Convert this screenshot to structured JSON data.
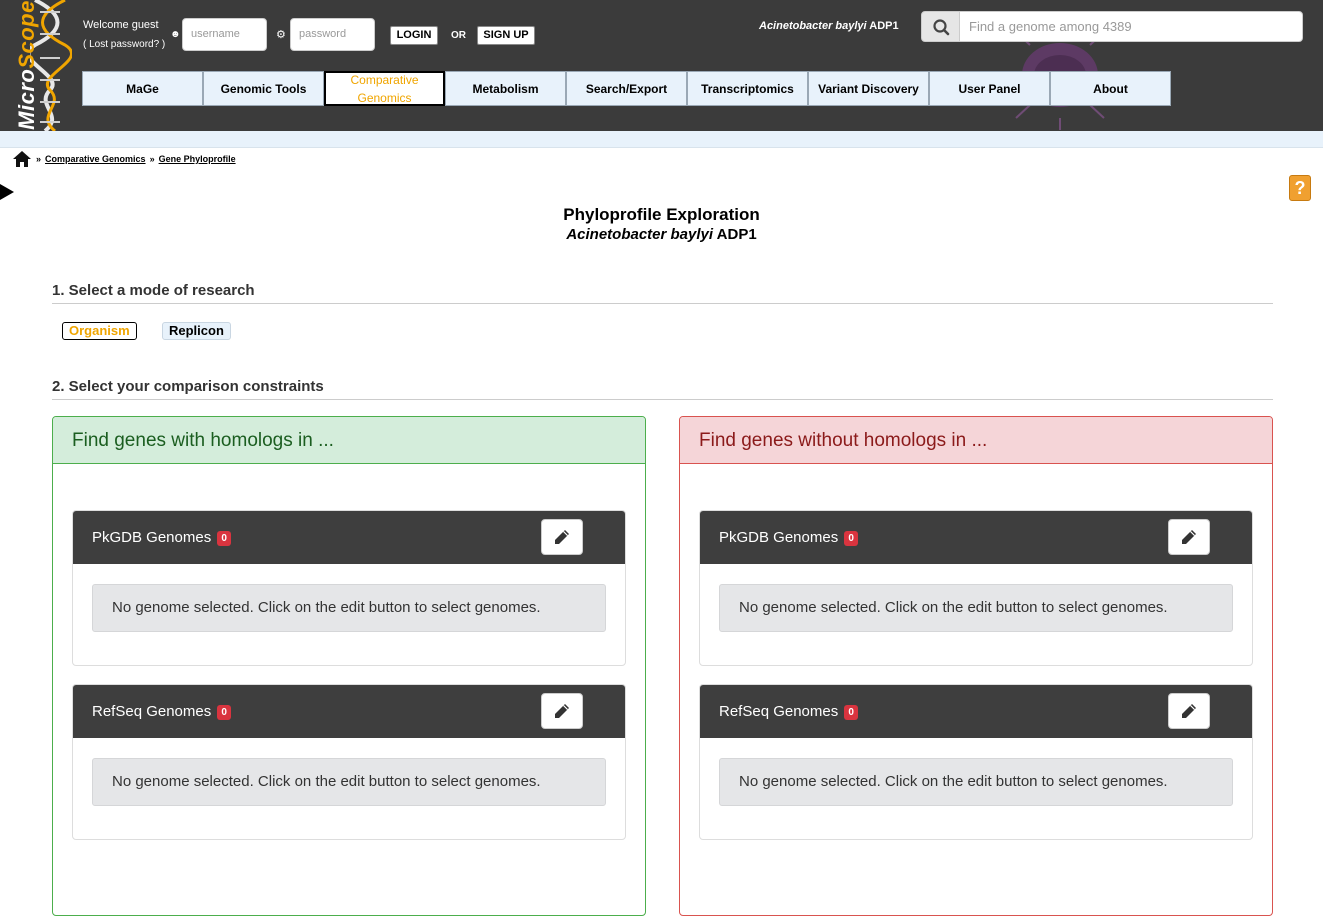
{
  "header": {
    "logo_micro": "Micro",
    "logo_scope": "Scope",
    "welcome": "Welcome guest",
    "lost_password": "( Lost password? )",
    "username_placeholder": "username",
    "password_placeholder": "password",
    "login_label": "LOGIN",
    "or_label": "OR",
    "signup_label": "SIGN UP",
    "organism_italic": "Acinetobacter baylyi",
    "organism_strain": "ADP1",
    "search_placeholder": "Find a genome among 4389"
  },
  "nav": {
    "items": [
      {
        "label": "MaGe"
      },
      {
        "label": "Genomic Tools"
      },
      {
        "label": "Comparative Genomics"
      },
      {
        "label": "Metabolism"
      },
      {
        "label": "Search/Export"
      },
      {
        "label": "Transcriptomics"
      },
      {
        "label": "Variant Discovery"
      },
      {
        "label": "User Panel"
      },
      {
        "label": "About"
      }
    ],
    "active_index": 2
  },
  "breadcrumb": {
    "sep": "»",
    "items": [
      "Comparative Genomics",
      "Gene Phyloprofile"
    ]
  },
  "page": {
    "title": "Phyloprofile Exploration",
    "subtitle_italic": "Acinetobacter baylyi",
    "subtitle_strain": "ADP1",
    "help": "?",
    "section1": "1. Select a mode of research",
    "mode_organism": "Organism",
    "mode_replicon": "Replicon",
    "section2": "2. Select your comparison constraints"
  },
  "panels": {
    "with": {
      "title": "Find genes with homologs in ...",
      "pkgdb_label": "PkGDB Genomes",
      "pkgdb_count": "0",
      "pkgdb_empty": "No genome selected. Click on the edit button to select genomes.",
      "refseq_label": "RefSeq Genomes",
      "refseq_count": "0",
      "refseq_empty": "No genome selected. Click on the edit button to select genomes."
    },
    "without": {
      "title": "Find genes without homologs in ...",
      "pkgdb_label": "PkGDB Genomes",
      "pkgdb_count": "0",
      "pkgdb_empty": "No genome selected. Click on the edit button to select genomes.",
      "refseq_label": "RefSeq Genomes",
      "refseq_count": "0",
      "refseq_empty": "No genome selected. Click on the edit button to select genomes."
    }
  },
  "colors": {
    "header_bg": "#3b3b3b",
    "accent": "#f0a500",
    "with_green": "#4cae4c",
    "without_red": "#d9534f",
    "badge_red": "#d9343f"
  }
}
